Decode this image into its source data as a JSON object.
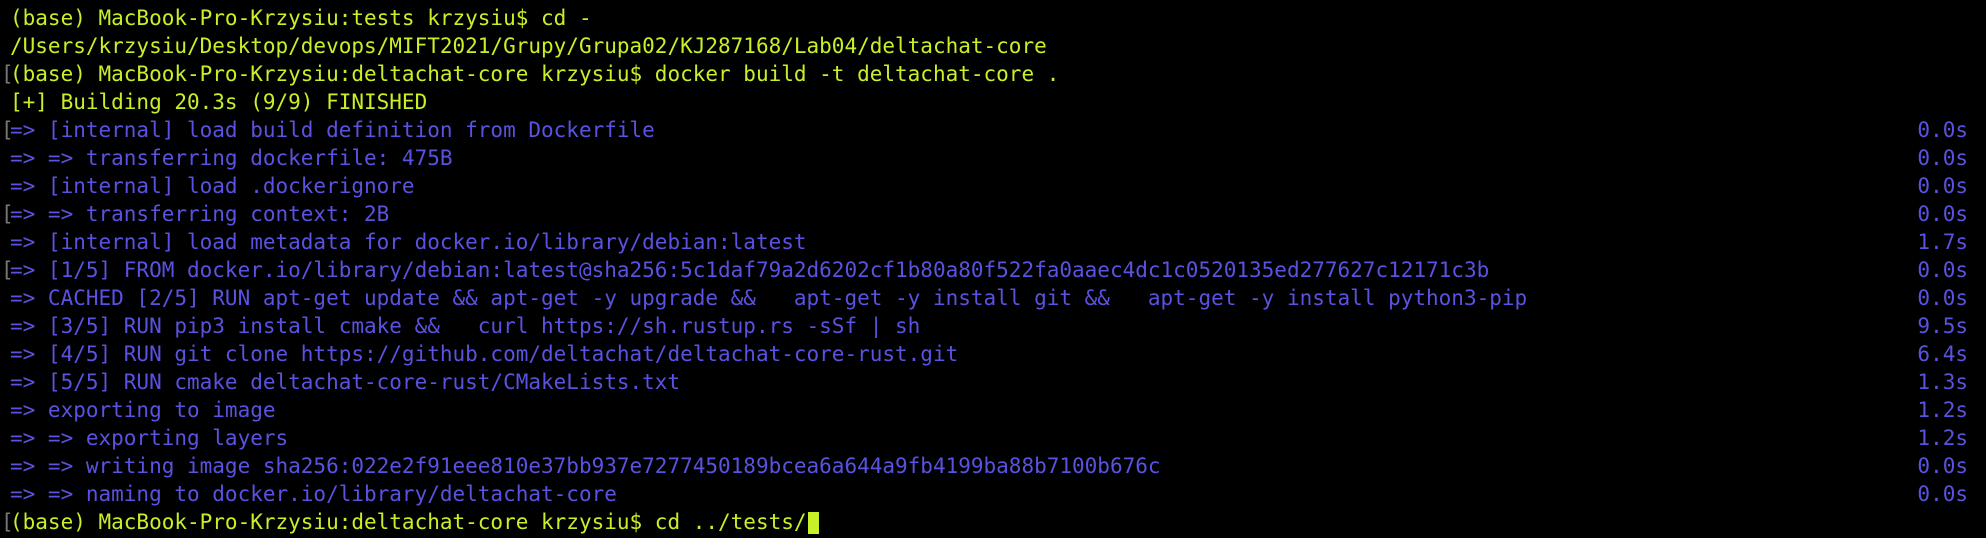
{
  "terminal": {
    "colors": {
      "background": "#000000",
      "prompt_text": "#c8f028",
      "build_text": "#5a52e0",
      "marker": "#777777"
    },
    "lines": [
      {
        "kind": "prompt",
        "marker": false,
        "text": "(base) MacBook-Pro-Krzysiu:tests krzysiu$ cd -",
        "time": ""
      },
      {
        "kind": "plain",
        "marker": false,
        "text": "/Users/krzysiu/Desktop/devops/MIFT2021/Grupy/Grupa02/KJ287168/Lab04/deltachat-core",
        "time": ""
      },
      {
        "kind": "prompt",
        "marker": true,
        "text": "(base) MacBook-Pro-Krzysiu:deltachat-core krzysiu$ docker build -t deltachat-core .",
        "time": ""
      },
      {
        "kind": "header",
        "marker": false,
        "text": "[+] Building 20.3s (9/9) FINISHED",
        "time": ""
      },
      {
        "kind": "build",
        "marker": true,
        "text": "=> [internal] load build definition from Dockerfile",
        "time": "0.0s"
      },
      {
        "kind": "build",
        "marker": false,
        "text": "=> => transferring dockerfile: 475B",
        "time": "0.0s"
      },
      {
        "kind": "build",
        "marker": false,
        "text": "=> [internal] load .dockerignore",
        "time": "0.0s"
      },
      {
        "kind": "build",
        "marker": true,
        "text": "=> => transferring context: 2B",
        "time": "0.0s"
      },
      {
        "kind": "build",
        "marker": false,
        "text": "=> [internal] load metadata for docker.io/library/debian:latest",
        "time": "1.7s"
      },
      {
        "kind": "build",
        "marker": true,
        "text": "=> [1/5] FROM docker.io/library/debian:latest@sha256:5c1daf79a2d6202cf1b80a80f522fa0aaec4dc1c0520135ed277627c12171c3b",
        "time": "0.0s"
      },
      {
        "kind": "build",
        "marker": false,
        "text": "=> CACHED [2/5] RUN apt-get update && apt-get -y upgrade &&   apt-get -y install git &&   apt-get -y install python3-pip",
        "time": "0.0s"
      },
      {
        "kind": "build",
        "marker": false,
        "text": "=> [3/5] RUN pip3 install cmake &&   curl https://sh.rustup.rs -sSf | sh",
        "time": "9.5s"
      },
      {
        "kind": "build",
        "marker": false,
        "text": "=> [4/5] RUN git clone https://github.com/deltachat/deltachat-core-rust.git",
        "time": "6.4s"
      },
      {
        "kind": "build",
        "marker": false,
        "text": "=> [5/5] RUN cmake deltachat-core-rust/CMakeLists.txt",
        "time": "1.3s"
      },
      {
        "kind": "build",
        "marker": false,
        "text": "=> exporting to image",
        "time": "1.2s"
      },
      {
        "kind": "build",
        "marker": false,
        "text": "=> => exporting layers",
        "time": "1.2s"
      },
      {
        "kind": "build",
        "marker": false,
        "text": "=> => writing image sha256:022e2f91eee810e37bb937e7277450189bcea6a644a9fb4199ba88b7100b676c",
        "time": "0.0s"
      },
      {
        "kind": "build",
        "marker": false,
        "text": "=> => naming to docker.io/library/deltachat-core",
        "time": "0.0s"
      },
      {
        "kind": "prompt",
        "marker": true,
        "text": "(base) MacBook-Pro-Krzysiu:deltachat-core krzysiu$ cd ../tests/",
        "time": ""
      }
    ]
  }
}
